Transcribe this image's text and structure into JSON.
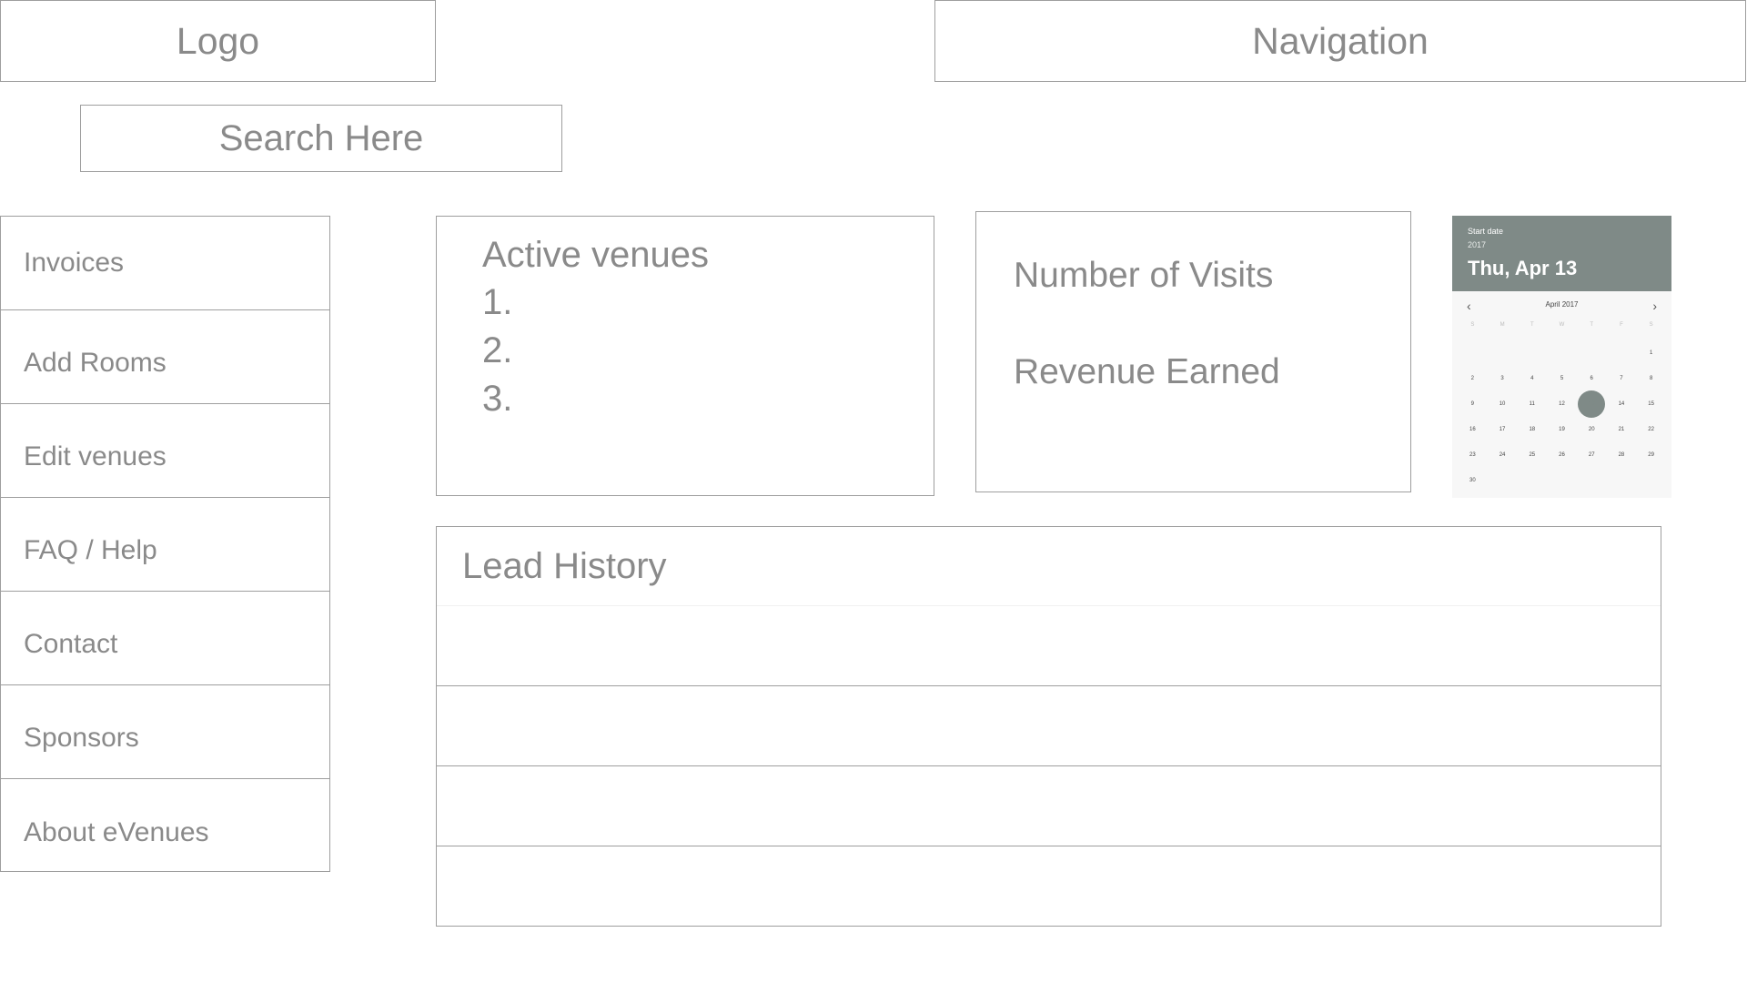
{
  "header": {
    "logo": "Logo",
    "navigation": "Navigation"
  },
  "search": {
    "placeholder": "Search Here"
  },
  "sidebar": {
    "items": [
      {
        "label": "Invoices"
      },
      {
        "label": "Add Rooms"
      },
      {
        "label": "Edit venues"
      },
      {
        "label": "FAQ / Help"
      },
      {
        "label": "Contact"
      },
      {
        "label": "Sponsors"
      },
      {
        "label": "About eVenues"
      }
    ]
  },
  "venues": {
    "title": "Active venues",
    "items": [
      "1.",
      "2.",
      "3."
    ]
  },
  "stats": {
    "visits_label": "Number of Visits",
    "revenue_label": "Revenue Earned"
  },
  "calendar": {
    "label": "Start date",
    "year": "2017",
    "selected_date": "Thu, Apr 13",
    "month": "April 2017",
    "prev_icon": "chevron-left-icon",
    "next_icon": "chevron-right-icon",
    "weekdays": [
      "S",
      "M",
      "T",
      "W",
      "T",
      "F",
      "S"
    ],
    "leading_blanks": 6,
    "days": [
      "1",
      "2",
      "3",
      "4",
      "5",
      "6",
      "7",
      "8",
      "9",
      "10",
      "11",
      "12",
      "13",
      "14",
      "15",
      "16",
      "17",
      "18",
      "19",
      "20",
      "21",
      "22",
      "23",
      "24",
      "25",
      "26",
      "27",
      "28",
      "29",
      "30"
    ],
    "selected_day": "13",
    "accent_color": "#7f8a87"
  },
  "lead_history": {
    "title": "Lead History",
    "rows": 4
  }
}
